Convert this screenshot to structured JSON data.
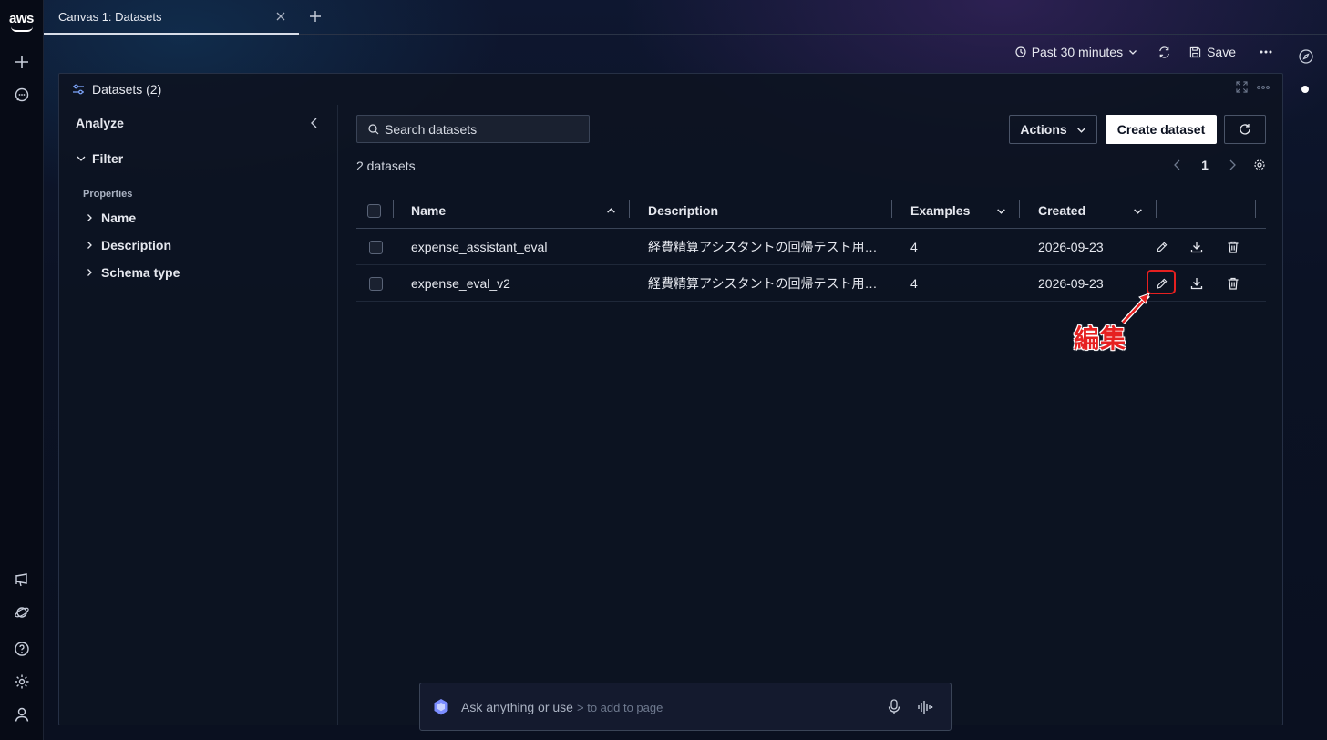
{
  "tab": {
    "title": "Canvas 1: Datasets"
  },
  "toolbar": {
    "time_range": "Past 30 minutes",
    "save_label": "Save"
  },
  "panel": {
    "title": "Datasets (2)"
  },
  "sidebar": {
    "analyze": "Analyze",
    "filter": "Filter",
    "properties": "Properties",
    "items": [
      "Name",
      "Description",
      "Schema type"
    ]
  },
  "main": {
    "search_placeholder": "Search datasets",
    "actions_label": "Actions",
    "create_label": "Create dataset",
    "count": "2 datasets",
    "page": "1",
    "columns": {
      "name": "Name",
      "description": "Description",
      "examples": "Examples",
      "created": "Created"
    },
    "rows": [
      {
        "name": "expense_assistant_eval",
        "description": "経費精算アシスタントの回帰テスト用…",
        "examples": "4",
        "created": "2026-09-23"
      },
      {
        "name": "expense_eval_v2",
        "description": "経費精算アシスタントの回帰テスト用…",
        "examples": "4",
        "created": "2026-09-23"
      }
    ]
  },
  "annotation": {
    "label": "編集",
    "color": "#e62020"
  },
  "ask": {
    "placeholder": "Ask anything or use",
    "hint": "> to add to page"
  },
  "icons": [
    "aws-logo",
    "plus-icon",
    "chat-icon",
    "megaphone-icon",
    "planet-icon",
    "help-icon",
    "gear-icon",
    "user-icon",
    "compass-icon",
    "clock-icon",
    "refresh-icon",
    "save-icon",
    "more-icon",
    "filter-sliders-icon",
    "expand-icon",
    "search-icon",
    "chevron-down-icon",
    "edit-icon",
    "download-icon",
    "trash-icon",
    "mic-icon",
    "waveform-icon"
  ]
}
